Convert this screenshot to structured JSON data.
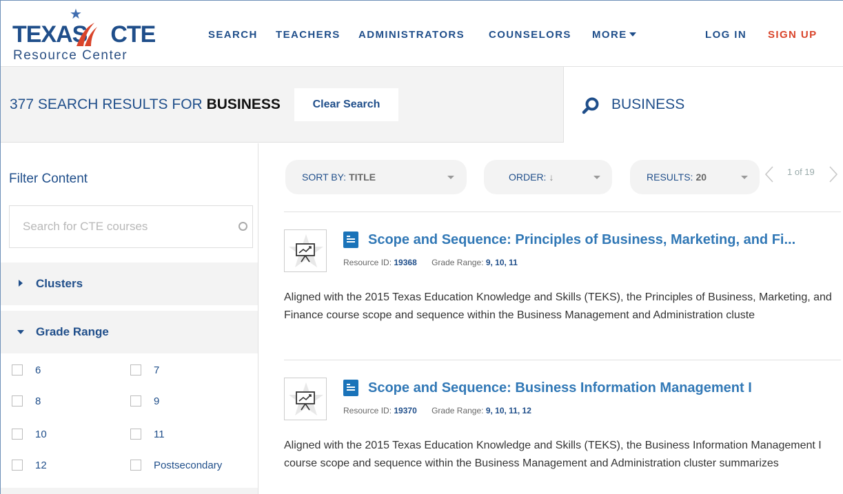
{
  "brand": {
    "logo_text": "TEXAS",
    "logo_text2": "CTE",
    "logo_sub": "Resource Center",
    "accent_blue": "#1f4e8a",
    "accent_red": "#d9442a"
  },
  "nav": {
    "items": [
      "SEARCH",
      "TEACHERS",
      "ADMINISTRATORS",
      "COUNSELORS",
      "MORE"
    ],
    "login": "LOG IN",
    "signup": "SIGN UP"
  },
  "search": {
    "count": "377",
    "results_label": "SEARCH RESULTS FOR",
    "query": "BUSINESS",
    "clear_label": "Clear Search",
    "box_value": "BUSINESS"
  },
  "sidebar": {
    "title": "Filter Content",
    "course_search_placeholder": "Search for CTE courses",
    "facets": [
      {
        "label": "Clusters",
        "expanded": false
      },
      {
        "label": "Grade Range",
        "expanded": true
      }
    ],
    "grade_options": [
      "6",
      "7",
      "8",
      "9",
      "10",
      "11",
      "12",
      "Postsecondary"
    ]
  },
  "toolbar": {
    "sort_label": "SORT BY:",
    "sort_value": "TITLE",
    "order_label": "ORDER:",
    "order_value": "↓",
    "results_label": "RESULTS:",
    "results_value": "20",
    "page_text": "1 of 19"
  },
  "results": [
    {
      "title": "Scope and Sequence: Principles of Business, Marketing, and Fi...",
      "resource_id_label": "Resource ID:",
      "resource_id": "19368",
      "grade_range_label": "Grade Range:",
      "grade_range": "9, 10, 11",
      "description": "Aligned with the 2015 Texas Education Knowledge and Skills (TEKS), the Principles of Business, Marketing, and Finance course scope and sequence within the Business Management and Administration cluste"
    },
    {
      "title": "Scope and Sequence: Business Information Management I",
      "resource_id_label": "Resource ID:",
      "resource_id": "19370",
      "grade_range_label": "Grade Range:",
      "grade_range": "9, 10, 11, 12",
      "description": "Aligned with the 2015 Texas Education Knowledge and Skills (TEKS), the Business Information Management I course scope and sequence within the Business Management and Administration cluster summarizes"
    }
  ]
}
